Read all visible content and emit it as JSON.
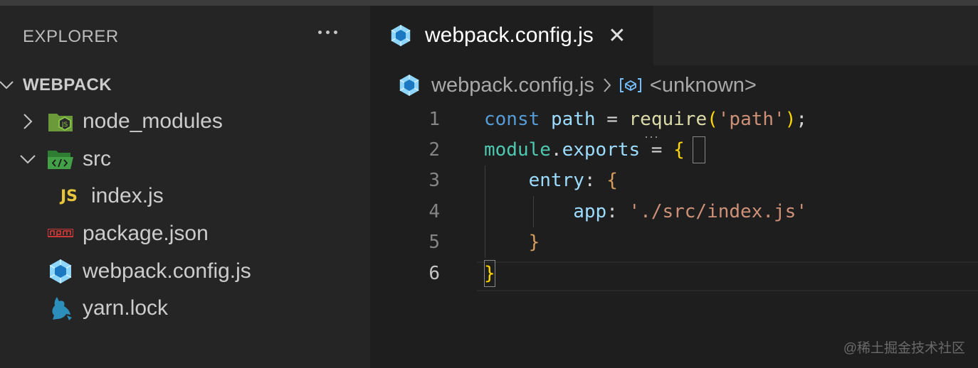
{
  "sidebar": {
    "title": "EXPLORER",
    "more_icon": "ellipsis-icon",
    "section": "WEBPACK",
    "items": [
      {
        "label": "node_modules",
        "icon": "nodejs-folder-icon",
        "expand": "chevron-right-icon"
      },
      {
        "label": "src",
        "icon": "src-folder-icon",
        "expand": "chevron-down-icon"
      },
      {
        "label": "index.js",
        "icon": "javascript-file-icon",
        "icon_text": "JS"
      },
      {
        "label": "package.json",
        "icon": "npm-icon"
      },
      {
        "label": "webpack.config.js",
        "icon": "webpack-icon"
      },
      {
        "label": "yarn.lock",
        "icon": "yarn-icon"
      }
    ]
  },
  "editor": {
    "tab": {
      "label": "webpack.config.js",
      "icon": "webpack-icon",
      "close": "✕"
    },
    "breadcrumb": {
      "file": "webpack.config.js",
      "symbol": "<unknown>"
    },
    "line_numbers": [
      "1",
      "2",
      "3",
      "4",
      "5",
      "6"
    ],
    "code": {
      "l1": {
        "kw": "const",
        "sp1": " ",
        "var": "path",
        "op": " = ",
        "fn": "require",
        "open": "(",
        "str": "'path'",
        "close": ")",
        "end": ";"
      },
      "l2": {
        "obj": "module",
        "dot": ".",
        "prop": "exports",
        "op": " = ",
        "brace": "{"
      },
      "l3": {
        "indent": "    ",
        "key": "entry",
        "colon": ": ",
        "brace": "{"
      },
      "l4": {
        "indent": "        ",
        "key": "app",
        "colon": ": ",
        "str": "'./src/index.js'"
      },
      "l5": {
        "indent": "    ",
        "brace": "}"
      },
      "l6": {
        "brace": "}"
      }
    }
  },
  "watermark": "@稀土掘金技术社区",
  "colors": {
    "accent_webpack": "#8ed6fb",
    "js_yellow": "#e8c53a",
    "node_green": "#8cc84b",
    "npm_red": "#cb3837",
    "yarn_blue": "#2c8ebb"
  }
}
